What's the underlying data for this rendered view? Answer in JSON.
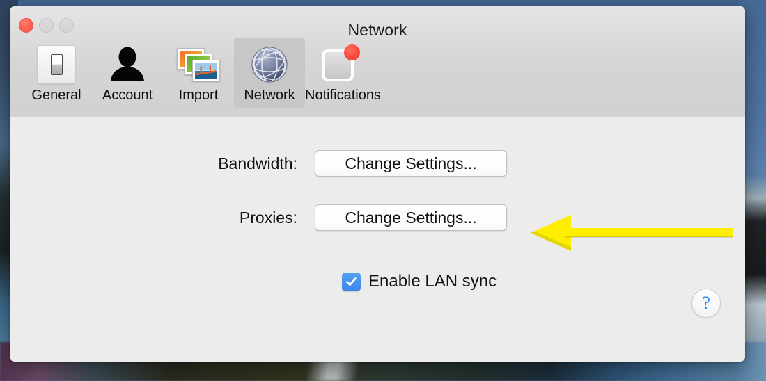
{
  "window": {
    "title": "Network",
    "traffic_lights": [
      {
        "name": "close",
        "color": "#ff6154",
        "active": true
      },
      {
        "name": "minimize",
        "color": "#d2d2d2",
        "active": false
      },
      {
        "name": "zoom",
        "color": "#d2d2d2",
        "active": false
      }
    ]
  },
  "toolbar": {
    "tabs": [
      {
        "label": "General",
        "icon": "light-switch-icon",
        "selected": false
      },
      {
        "label": "Account",
        "icon": "person-silhouette-icon",
        "selected": false
      },
      {
        "label": "Import",
        "icon": "stacked-photos-icon",
        "selected": false
      },
      {
        "label": "Network",
        "icon": "globe-icon",
        "selected": true
      },
      {
        "label": "Notifications",
        "icon": "notification-square-icon",
        "selected": false,
        "badge": true
      }
    ]
  },
  "content": {
    "rows": [
      {
        "label": "Bandwidth:",
        "button": "Change Settings..."
      },
      {
        "label": "Proxies:",
        "button": "Change Settings..."
      }
    ],
    "checkbox": {
      "label": "Enable LAN sync",
      "checked": true,
      "accent": "#3d86e8"
    },
    "help_button": {
      "glyph": "?",
      "color": "#1a7ded"
    }
  },
  "annotation": {
    "type": "arrow",
    "direction": "left",
    "color": "#ffee00",
    "points_at": "Proxies: Change Settings..."
  }
}
